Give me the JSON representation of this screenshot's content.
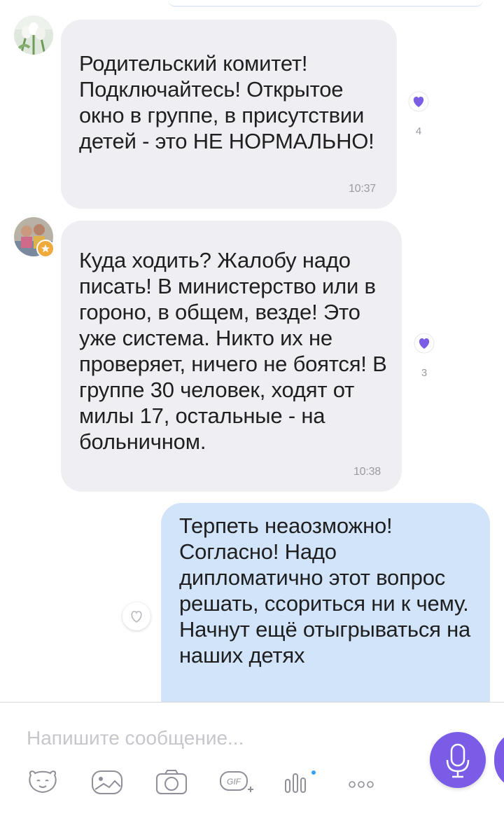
{
  "colors": {
    "accent": "#7a5ce7",
    "incoming_bubble": "#eeeef3",
    "outgoing_bubble": "#d1e4fa",
    "time_text": "#9a9aa3"
  },
  "messages": [
    {
      "direction": "incoming",
      "text": "Родительский комитет! Подключайтесь! Открытое окно в группе, в присутствии детей - это НЕ НОРМАЛЬНО!",
      "time": "10:37",
      "likes": "4",
      "avatar_icon": "tulips-avatar"
    },
    {
      "direction": "incoming",
      "text": "Куда ходить? Жалобу надо писать! В министерство или в гороно, в общем, везде! Это уже система. Никто их не проверяет, ничего не боятся! В группе 30 человек, ходят от милы 17, остальные - на больничном.",
      "time": "10:38",
      "likes": "3",
      "avatar_icon": "family-photo-avatar"
    },
    {
      "direction": "outgoing",
      "text": "Терпеть неаозможно! Согласно! Надо дипломатично этот вопрос решать, ссориться ни к чему. Начнут ещё отыгрываться на наших детях"
    }
  ],
  "composer": {
    "placeholder": "Напишите сообщение...",
    "tools": [
      "sticker-icon",
      "image-icon",
      "camera-icon",
      "gif-icon",
      "voice-message-icon",
      "more-icon"
    ],
    "gif_label": "GIF",
    "send_icon": "microphone-icon"
  }
}
